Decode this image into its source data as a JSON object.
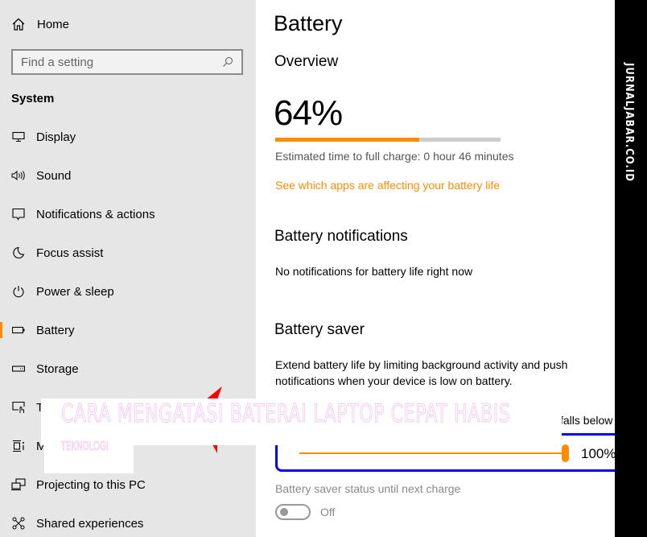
{
  "sidebar": {
    "home_label": "Home",
    "search_placeholder": "Find a setting",
    "section_title": "System",
    "items": [
      {
        "label": "Display",
        "icon": "display-icon"
      },
      {
        "label": "Sound",
        "icon": "sound-icon"
      },
      {
        "label": "Notifications & actions",
        "icon": "notifications-icon"
      },
      {
        "label": "Focus assist",
        "icon": "focus-assist-icon"
      },
      {
        "label": "Power & sleep",
        "icon": "power-icon"
      },
      {
        "label": "Battery",
        "icon": "battery-icon",
        "active": true
      },
      {
        "label": "Storage",
        "icon": "storage-icon"
      },
      {
        "label": "T",
        "icon": "tablet-mode-icon"
      },
      {
        "label": "M",
        "icon": "multitasking-icon"
      },
      {
        "label": "Projecting to this PC",
        "icon": "projecting-icon"
      },
      {
        "label": "Shared experiences",
        "icon": "shared-experiences-icon"
      }
    ]
  },
  "main": {
    "title": "Battery",
    "overview": {
      "heading": "Overview",
      "percent_label": "64%",
      "percent_value": 64,
      "estimate": "Estimated time to full charge: 0 hour 46 minutes",
      "link": "See which apps are affecting your battery life"
    },
    "notifications": {
      "heading": "Battery notifications",
      "text": "No notifications for battery life right now"
    },
    "saver": {
      "heading": "Battery saver",
      "description": "Extend battery life by limiting background activity and push notifications when your device is low on battery.",
      "falls_below": "falls below",
      "slider_value": 100,
      "slider_label": "100%",
      "status_label": "Battery saver status until next charge",
      "toggle_state": "Off"
    }
  },
  "overlay": {
    "title": "CARA MENGATASI BATERAI LAPTOP CEPAT HABIS",
    "category": "TEKNOLOGI"
  },
  "watermark": "JURNALJABAR.CO.ID",
  "colors": {
    "accent": "#ff8c00",
    "sidebar_bg": "#e6e6e6",
    "highlight_border": "#0000ff"
  }
}
